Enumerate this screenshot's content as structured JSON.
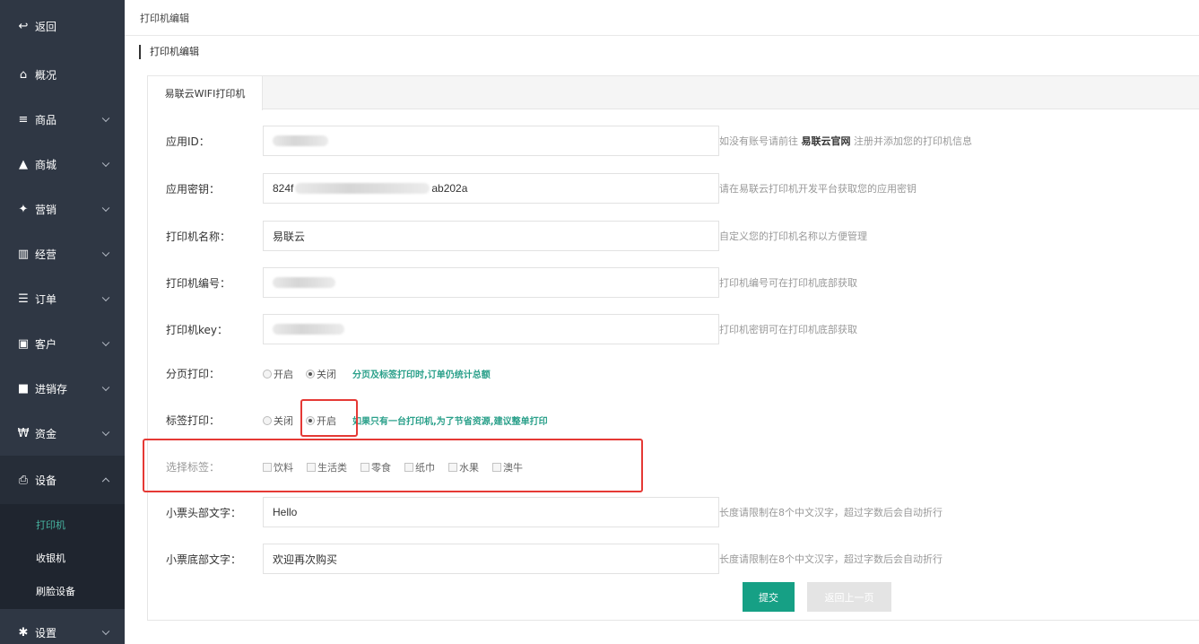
{
  "sidebar": {
    "items": [
      {
        "label": "返回",
        "icon": "back-arrow-icon",
        "glyph": "↩"
      },
      {
        "label": "概况",
        "icon": "home-icon",
        "glyph": "⌂"
      },
      {
        "label": "商品",
        "icon": "list-icon",
        "glyph": "≡"
      },
      {
        "label": "商城",
        "icon": "shopping-bag-icon",
        "glyph": "▲"
      },
      {
        "label": "营销",
        "icon": "gift-icon",
        "glyph": "✦"
      },
      {
        "label": "经营",
        "icon": "bar-chart-icon",
        "glyph": "▥"
      },
      {
        "label": "订单",
        "icon": "list-lines-icon",
        "glyph": "☰"
      },
      {
        "label": "客户",
        "icon": "id-card-icon",
        "glyph": "▣"
      },
      {
        "label": "进销存",
        "icon": "truck-icon",
        "glyph": "■"
      },
      {
        "label": "资金",
        "icon": "won-currency-icon",
        "glyph": "₩"
      },
      {
        "label": "设备",
        "icon": "printer-icon",
        "glyph": "⎙"
      },
      {
        "label": "设置",
        "icon": "gear-icon",
        "glyph": "✱"
      }
    ],
    "sub_items": [
      {
        "label": "打印机"
      },
      {
        "label": "收银机"
      },
      {
        "label": "刷脸设备"
      }
    ]
  },
  "breadcrumb": "打印机编辑",
  "section_title": "打印机编辑",
  "tab": "易联云WIFI打印机",
  "form": {
    "app_id": {
      "label": "应用ID：",
      "hint_prefix": "如没有账号请前往",
      "hint_link": "易联云官网",
      "hint_suffix": "注册并添加您的打印机信息"
    },
    "app_secret": {
      "label": "应用密钥：",
      "value_start": "824f",
      "value_end": "ab202a",
      "hint": "请在易联云打印机开发平台获取您的应用密钥"
    },
    "printer_name": {
      "label": "打印机名称：",
      "value": "易联云",
      "hint": "自定义您的打印机名称以方便管理"
    },
    "printer_no": {
      "label": "打印机编号：",
      "hint": "打印机编号可在打印机底部获取"
    },
    "printer_key": {
      "label": "打印机key：",
      "hint": "打印机密钥可在打印机底部获取"
    },
    "page_print": {
      "label": "分页打印：",
      "opt_on": "开启",
      "opt_off": "关闭",
      "selected": "关闭",
      "note": "分页及标签打印时,订单仍统计总额"
    },
    "label_print": {
      "label": "标签打印：",
      "opt_off": "关闭",
      "opt_on": "开启",
      "selected": "开启",
      "note": "如果只有一台打印机,为了节省资源,建议整单打印"
    },
    "select_labels": {
      "label": "选择标签：",
      "options": [
        "饮料",
        "生活类",
        "零食",
        "纸巾",
        "水果",
        "澳牛"
      ]
    },
    "header_text": {
      "label": "小票头部文字：",
      "value": "Hello",
      "hint": "长度请限制在8个中文汉字，超过字数后会自动折行"
    },
    "footer_text": {
      "label": "小票底部文字：",
      "value": "欢迎再次购买",
      "hint": "长度请限制在8个中文汉字，超过字数后会自动折行"
    }
  },
  "buttons": {
    "submit": "提交",
    "back": "返回上一页"
  },
  "colors": {
    "sidebar_bg": "#2f3744",
    "accent": "#16a085",
    "highlight_box": "#e53935"
  }
}
